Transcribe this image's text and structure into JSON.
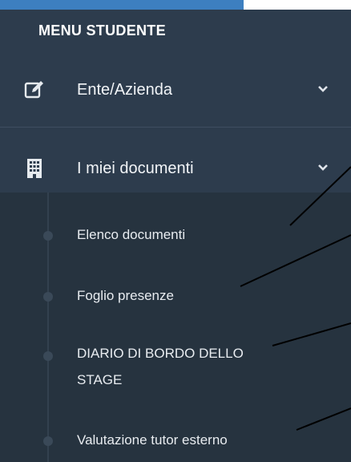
{
  "menu": {
    "header": "MENU STUDENTE",
    "items": [
      {
        "label": "Ente/Azienda",
        "icon": "edit-icon",
        "expanded": false
      },
      {
        "label": "I miei documenti",
        "icon": "building-icon",
        "expanded": true,
        "children": [
          {
            "label": "Elenco documenti"
          },
          {
            "label": "Foglio presenze"
          },
          {
            "label": "DIARIO DI BORDO DELLO STAGE"
          },
          {
            "label": "Valutazione tutor esterno"
          }
        ]
      }
    ]
  },
  "colors": {
    "accent": "#3d7fc0",
    "sidebar_bg": "#2d3c4d",
    "submenu_bg": "#26333f",
    "text": "#f1f4f7"
  }
}
